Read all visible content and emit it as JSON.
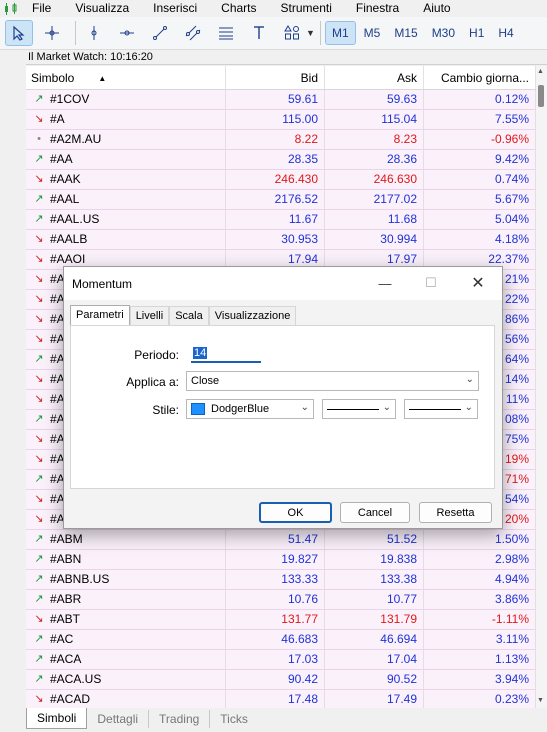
{
  "menu": [
    "File",
    "Visualizza",
    "Inserisci",
    "Charts",
    "Strumenti",
    "Finestra",
    "Aiuto"
  ],
  "toolbar": {
    "timeframes": [
      "M1",
      "M5",
      "M15",
      "M30",
      "H1",
      "H4"
    ],
    "active_timeframe": "M1"
  },
  "market_watch": {
    "title": "Il Market Watch: 10:16:20",
    "columns": {
      "symbol": "Simbolo",
      "bid": "Bid",
      "ask": "Ask",
      "change": "Cambio giorna..."
    },
    "rows": [
      {
        "symbol": "#1COV",
        "bid": "59.61",
        "ask": "59.63",
        "change": "0.12%",
        "dir": "up",
        "bid_color": "up",
        "ask_color": "up",
        "chg_color": "up"
      },
      {
        "symbol": "#A",
        "bid": "115.00",
        "ask": "115.04",
        "change": "7.55%",
        "dir": "down",
        "bid_color": "up",
        "ask_color": "up",
        "chg_color": "up"
      },
      {
        "symbol": "#A2M.AU",
        "bid": "8.22",
        "ask": "8.23",
        "change": "-0.96%",
        "dir": "flat",
        "bid_color": "down",
        "ask_color": "down",
        "chg_color": "down"
      },
      {
        "symbol": "#AA",
        "bid": "28.35",
        "ask": "28.36",
        "change": "9.42%",
        "dir": "up",
        "bid_color": "up",
        "ask_color": "up",
        "chg_color": "up"
      },
      {
        "symbol": "#AAK",
        "bid": "246.430",
        "ask": "246.630",
        "change": "0.74%",
        "dir": "down",
        "bid_color": "down",
        "ask_color": "down",
        "chg_color": "up"
      },
      {
        "symbol": "#AAL",
        "bid": "2176.52",
        "ask": "2177.02",
        "change": "5.67%",
        "dir": "up",
        "bid_color": "up",
        "ask_color": "up",
        "chg_color": "up"
      },
      {
        "symbol": "#AAL.US",
        "bid": "11.67",
        "ask": "11.68",
        "change": "5.04%",
        "dir": "up",
        "bid_color": "up",
        "ask_color": "up",
        "chg_color": "up"
      },
      {
        "symbol": "#AALB",
        "bid": "30.953",
        "ask": "30.994",
        "change": "4.18%",
        "dir": "down",
        "bid_color": "up",
        "ask_color": "up",
        "chg_color": "up"
      },
      {
        "symbol": "#AAOI",
        "bid": "17.94",
        "ask": "17.97",
        "change": "22.37%",
        "dir": "down",
        "bid_color": "up",
        "ask_color": "up",
        "chg_color": "up"
      },
      {
        "symbol": "#A",
        "bid": "",
        "ask": "",
        "change": "21%",
        "dir": "down",
        "bid_color": "up",
        "ask_color": "up",
        "chg_color": "up"
      },
      {
        "symbol": "#A",
        "bid": "",
        "ask": "",
        "change": "22%",
        "dir": "down",
        "bid_color": "up",
        "ask_color": "up",
        "chg_color": "up"
      },
      {
        "symbol": "#A",
        "bid": "",
        "ask": "",
        "change": "86%",
        "dir": "down",
        "bid_color": "up",
        "ask_color": "up",
        "chg_color": "up"
      },
      {
        "symbol": "#A",
        "bid": "",
        "ask": "",
        "change": "56%",
        "dir": "down",
        "bid_color": "up",
        "ask_color": "up",
        "chg_color": "up"
      },
      {
        "symbol": "#A",
        "bid": "",
        "ask": "",
        "change": "64%",
        "dir": "up",
        "bid_color": "up",
        "ask_color": "up",
        "chg_color": "up"
      },
      {
        "symbol": "#A",
        "bid": "",
        "ask": "",
        "change": "14%",
        "dir": "down",
        "bid_color": "up",
        "ask_color": "up",
        "chg_color": "up"
      },
      {
        "symbol": "#A",
        "bid": "",
        "ask": "",
        "change": "11%",
        "dir": "down",
        "bid_color": "up",
        "ask_color": "up",
        "chg_color": "up"
      },
      {
        "symbol": "#A",
        "bid": "",
        "ask": "",
        "change": "08%",
        "dir": "up",
        "bid_color": "up",
        "ask_color": "up",
        "chg_color": "up"
      },
      {
        "symbol": "#A",
        "bid": "",
        "ask": "",
        "change": "75%",
        "dir": "down",
        "bid_color": "up",
        "ask_color": "up",
        "chg_color": "up"
      },
      {
        "symbol": "#A",
        "bid": "",
        "ask": "",
        "change": "19%",
        "dir": "down",
        "bid_color": "up",
        "ask_color": "up",
        "chg_color": "down"
      },
      {
        "symbol": "#A",
        "bid": "",
        "ask": "",
        "change": "71%",
        "dir": "up",
        "bid_color": "up",
        "ask_color": "up",
        "chg_color": "down"
      },
      {
        "symbol": "#A",
        "bid": "",
        "ask": "",
        "change": "54%",
        "dir": "down",
        "bid_color": "up",
        "ask_color": "up",
        "chg_color": "up"
      },
      {
        "symbol": "#A",
        "bid": "",
        "ask": "",
        "change": "20%",
        "dir": "down",
        "bid_color": "up",
        "ask_color": "up",
        "chg_color": "down"
      },
      {
        "symbol": "#ABM",
        "bid": "51.47",
        "ask": "51.52",
        "change": "1.50%",
        "dir": "up",
        "bid_color": "up",
        "ask_color": "up",
        "chg_color": "up"
      },
      {
        "symbol": "#ABN",
        "bid": "19.827",
        "ask": "19.838",
        "change": "2.98%",
        "dir": "up",
        "bid_color": "up",
        "ask_color": "up",
        "chg_color": "up"
      },
      {
        "symbol": "#ABNB.US",
        "bid": "133.33",
        "ask": "133.38",
        "change": "4.94%",
        "dir": "up",
        "bid_color": "up",
        "ask_color": "up",
        "chg_color": "up"
      },
      {
        "symbol": "#ABR",
        "bid": "10.76",
        "ask": "10.77",
        "change": "3.86%",
        "dir": "up",
        "bid_color": "up",
        "ask_color": "up",
        "chg_color": "up"
      },
      {
        "symbol": "#ABT",
        "bid": "131.77",
        "ask": "131.79",
        "change": "-1.11%",
        "dir": "down",
        "bid_color": "down",
        "ask_color": "down",
        "chg_color": "down"
      },
      {
        "symbol": "#AC",
        "bid": "46.683",
        "ask": "46.694",
        "change": "3.11%",
        "dir": "up",
        "bid_color": "up",
        "ask_color": "up",
        "chg_color": "up"
      },
      {
        "symbol": "#ACA",
        "bid": "17.03",
        "ask": "17.04",
        "change": "1.13%",
        "dir": "up",
        "bid_color": "up",
        "ask_color": "up",
        "chg_color": "up"
      },
      {
        "symbol": "#ACA.US",
        "bid": "90.42",
        "ask": "90.52",
        "change": "3.94%",
        "dir": "up",
        "bid_color": "up",
        "ask_color": "up",
        "chg_color": "up"
      },
      {
        "symbol": "#ACAD",
        "bid": "17.48",
        "ask": "17.49",
        "change": "0.23%",
        "dir": "down",
        "bid_color": "up",
        "ask_color": "up",
        "chg_color": "up"
      }
    ]
  },
  "bottom_tabs": [
    "Simboli",
    "Dettagli",
    "Trading",
    "Ticks"
  ],
  "dialog": {
    "title": "Momentum",
    "tabs": [
      "Parametri",
      "Livelli",
      "Scala",
      "Visualizzazione"
    ],
    "periodo_label": "Periodo:",
    "periodo_value": "14",
    "applica_label": "Applica a:",
    "applica_value": "Close",
    "stile_label": "Stile:",
    "stile_color_name": "DodgerBlue",
    "stile_color": "#1e90ff",
    "ok": "OK",
    "cancel": "Cancel",
    "reset": "Resetta"
  },
  "colors": {
    "up": "#1f33d6",
    "down": "#e01818",
    "arrow_up": "#1a9a3a",
    "arrow_down": "#d42020"
  }
}
